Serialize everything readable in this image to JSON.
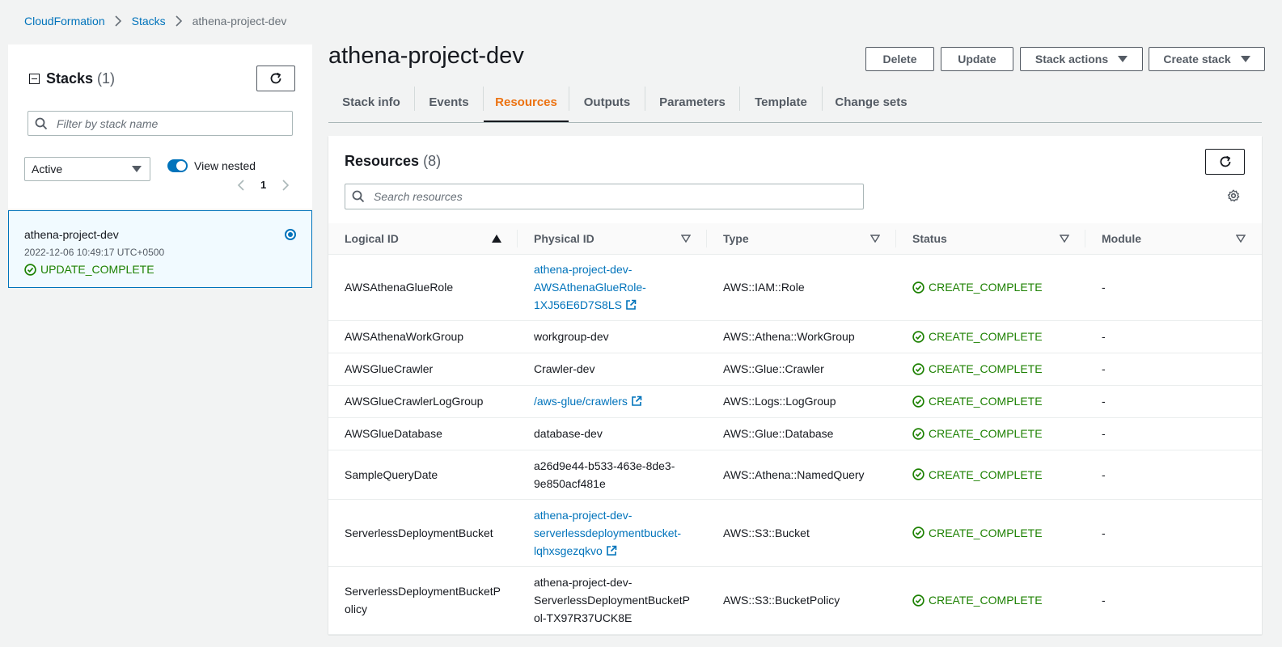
{
  "breadcrumb": {
    "items": [
      "CloudFormation",
      "Stacks"
    ],
    "current": "athena-project-dev"
  },
  "left_panel": {
    "title": "Stacks",
    "count": "(1)",
    "filter_placeholder": "Filter by stack name",
    "status_filter": "Active",
    "view_nested_label": "View nested",
    "page": "1",
    "stacks": [
      {
        "name": "athena-project-dev",
        "date": "2022-12-06 10:49:17 UTC+0500",
        "status": "UPDATE_COMPLETE"
      }
    ]
  },
  "header": {
    "title": "athena-project-dev",
    "buttons": {
      "delete": "Delete",
      "update": "Update",
      "stack_actions": "Stack actions",
      "create_stack": "Create stack"
    }
  },
  "tabs": [
    "Stack info",
    "Events",
    "Resources",
    "Outputs",
    "Parameters",
    "Template",
    "Change sets"
  ],
  "active_tab": "Resources",
  "resources": {
    "title": "Resources",
    "count": "(8)",
    "search_placeholder": "Search resources",
    "columns": [
      "Logical ID",
      "Physical ID",
      "Type",
      "Status",
      "Module"
    ],
    "rows": [
      {
        "logical": "AWSAthenaGlueRole",
        "physical": [
          "athena-project-dev-",
          "AWSAthenaGlueRole-",
          "1XJ56E6D7S8LS"
        ],
        "physical_link": true,
        "type": "AWS::IAM::Role",
        "status": "CREATE_COMPLETE",
        "module": "-"
      },
      {
        "logical": "AWSAthenaWorkGroup",
        "physical": [
          "workgroup-dev"
        ],
        "physical_link": false,
        "type": "AWS::Athena::WorkGroup",
        "status": "CREATE_COMPLETE",
        "module": "-"
      },
      {
        "logical": "AWSGlueCrawler",
        "physical": [
          "Crawler-dev"
        ],
        "physical_link": false,
        "type": "AWS::Glue::Crawler",
        "status": "CREATE_COMPLETE",
        "module": "-"
      },
      {
        "logical": "AWSGlueCrawlerLogGroup",
        "physical": [
          "/aws-glue/crawlers"
        ],
        "physical_link": true,
        "type": "AWS::Logs::LogGroup",
        "status": "CREATE_COMPLETE",
        "module": "-"
      },
      {
        "logical": "AWSGlueDatabase",
        "physical": [
          "database-dev"
        ],
        "physical_link": false,
        "type": "AWS::Glue::Database",
        "status": "CREATE_COMPLETE",
        "module": "-"
      },
      {
        "logical": "SampleQueryDate",
        "physical": [
          "a26d9e44-b533-463e-8de3-",
          "9e850acf481e"
        ],
        "physical_link": false,
        "type": "AWS::Athena::NamedQuery",
        "status": "CREATE_COMPLETE",
        "module": "-"
      },
      {
        "logical": "ServerlessDeploymentBucket",
        "physical": [
          "athena-project-dev-",
          "serverlessdeploymentbucket-",
          "lqhxsgezqkvo"
        ],
        "physical_link": true,
        "type": "AWS::S3::Bucket",
        "status": "CREATE_COMPLETE",
        "module": "-"
      },
      {
        "logical": "ServerlessDeploymentBucketP\nolicy",
        "physical": [
          "athena-project-dev-",
          "ServerlessDeploymentBucketP",
          "ol-TX97R37UCK8E"
        ],
        "physical_link": false,
        "type": "AWS::S3::BucketPolicy",
        "status": "CREATE_COMPLETE",
        "module": "-"
      }
    ]
  },
  "colors": {
    "link": "#0073bb",
    "success": "#1d8102",
    "active_tab": "#ec7211"
  }
}
